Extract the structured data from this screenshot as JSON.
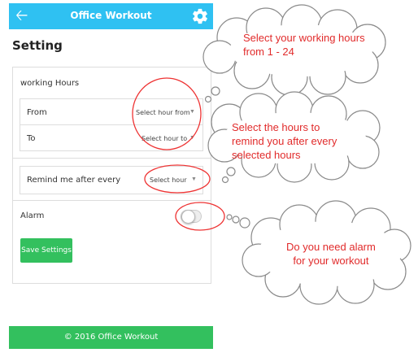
{
  "app_bar": {
    "title": "Office Workout",
    "back_icon": "arrow-left-icon",
    "settings_icon": "gear-icon",
    "color": "#2fc1f2"
  },
  "page": {
    "title": "Setting"
  },
  "working_hours": {
    "label": "working Hours",
    "from_label": "From",
    "from_value": "Select hour from",
    "to_label": "To",
    "to_value": "Select hour to"
  },
  "remind": {
    "label": "Remind me after every",
    "value": "Select hour"
  },
  "alarm": {
    "label": "Alarm",
    "enabled": false
  },
  "save_button": {
    "label": "Save Settings",
    "color": "#33c05e"
  },
  "footer": {
    "text": "© 2016 Office Workout"
  },
  "annotations": {
    "cloud1": [
      "Select your working hours",
      "from 1 - 24"
    ],
    "cloud2": [
      "Select the hours to",
      "remind you after every",
      "selected hours"
    ],
    "cloud3": [
      "Do you need alarm",
      "for  your workout"
    ],
    "text_color": "#e12b2b"
  }
}
